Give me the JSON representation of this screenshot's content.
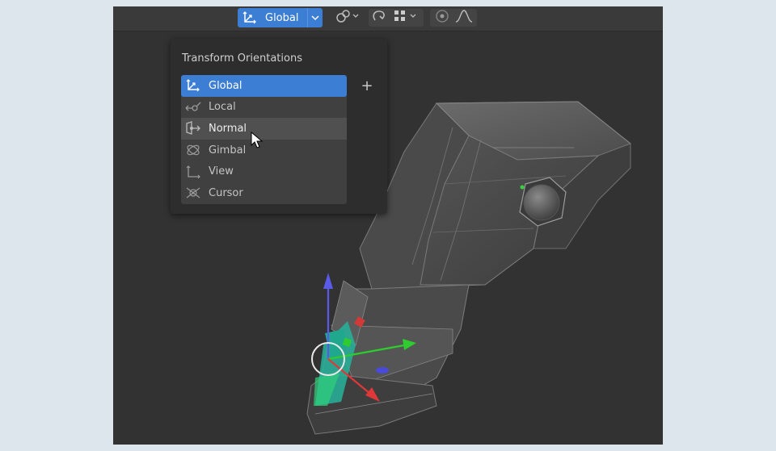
{
  "header": {
    "orientation_label": "Global",
    "accent": "#3b7ed3"
  },
  "menu": {
    "title": "Transform Orientations",
    "add_label": "+",
    "items": [
      {
        "label": "Global",
        "icon": "global-orientation-icon",
        "state": "selected"
      },
      {
        "label": "Local",
        "icon": "local-orientation-icon",
        "state": "normal"
      },
      {
        "label": "Normal",
        "icon": "normal-orientation-icon",
        "state": "hover"
      },
      {
        "label": "Gimbal",
        "icon": "gimbal-orientation-icon",
        "state": "normal"
      },
      {
        "label": "View",
        "icon": "view-orientation-icon",
        "state": "normal"
      },
      {
        "label": "Cursor",
        "icon": "cursor-orientation-icon",
        "state": "normal"
      }
    ]
  },
  "header_icons": [
    "pivot-point-icon",
    "snap-icon",
    "snap-increment-icon",
    "proportional-editing-icon",
    "falloff-curve-icon"
  ]
}
